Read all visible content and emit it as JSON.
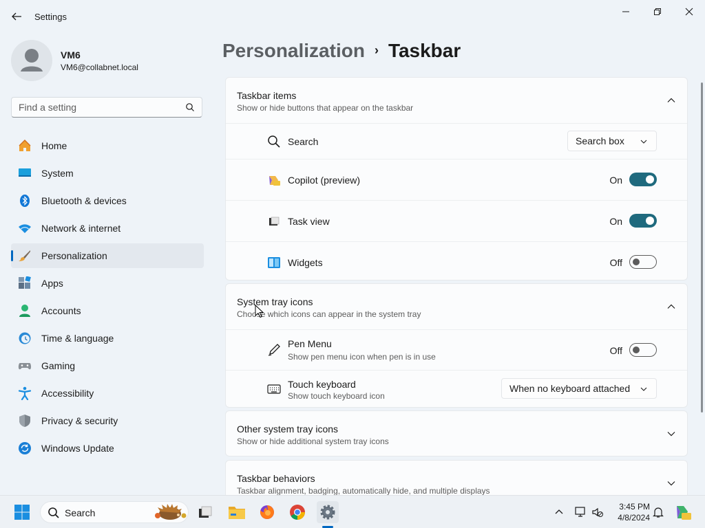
{
  "app": {
    "title": "Settings"
  },
  "profile": {
    "name": "VM6",
    "email": "VM6@collabnet.local"
  },
  "search": {
    "placeholder": "Find a setting"
  },
  "nav": [
    {
      "label": "Home",
      "icon": "home-icon"
    },
    {
      "label": "System",
      "icon": "system-icon"
    },
    {
      "label": "Bluetooth & devices",
      "icon": "bluetooth-icon"
    },
    {
      "label": "Network & internet",
      "icon": "wifi-icon"
    },
    {
      "label": "Personalization",
      "icon": "brush-icon",
      "selected": true
    },
    {
      "label": "Apps",
      "icon": "apps-icon"
    },
    {
      "label": "Accounts",
      "icon": "accounts-icon"
    },
    {
      "label": "Time & language",
      "icon": "time-language-icon"
    },
    {
      "label": "Gaming",
      "icon": "gaming-icon"
    },
    {
      "label": "Accessibility",
      "icon": "accessibility-icon"
    },
    {
      "label": "Privacy & security",
      "icon": "shield-icon"
    },
    {
      "label": "Windows Update",
      "icon": "update-icon"
    }
  ],
  "breadcrumb": {
    "parent": "Personalization",
    "separator": "›",
    "current": "Taskbar"
  },
  "taskbar_items": {
    "title": "Taskbar items",
    "subtitle": "Show or hide buttons that appear on the taskbar",
    "search": {
      "label": "Search",
      "value": "Search box"
    },
    "copilot": {
      "label": "Copilot (preview)",
      "state": "On"
    },
    "task_view": {
      "label": "Task view",
      "state": "On"
    },
    "widgets": {
      "label": "Widgets",
      "state": "Off"
    }
  },
  "system_tray": {
    "title": "System tray icons",
    "subtitle": "Choose which icons can appear in the system tray",
    "pen_menu": {
      "label": "Pen Menu",
      "subtitle": "Show pen menu icon when pen is in use",
      "state": "Off"
    },
    "touch_keyboard": {
      "label": "Touch keyboard",
      "subtitle": "Show touch keyboard icon",
      "value": "When no keyboard attached"
    }
  },
  "other_tray": {
    "title": "Other system tray icons",
    "subtitle": "Show or hide additional system tray icons"
  },
  "behaviors": {
    "title": "Taskbar behaviors",
    "subtitle": "Taskbar alignment, badging, automatically hide, and multiple displays"
  },
  "taskbar": {
    "search_label": "Search",
    "time": "3:45 PM",
    "date": "4/8/2024"
  },
  "colors": {
    "accent": "#0067c0",
    "toggle_on": "#1f6a7e"
  }
}
